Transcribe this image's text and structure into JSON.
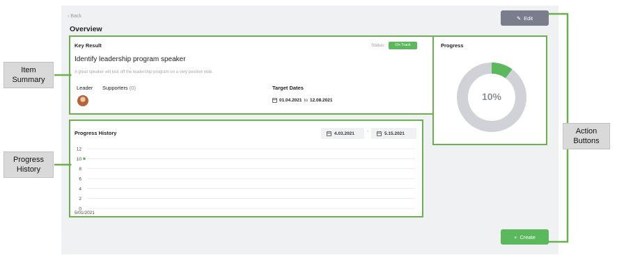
{
  "nav": {
    "back_label": "Back"
  },
  "page": {
    "title": "Overview"
  },
  "key_result": {
    "section_label": "Key Result",
    "status_label": "Status:",
    "status_badge": "On Track",
    "title": "Identify leadership program speaker",
    "description": "A great speaker will kick off the leadership program on a very positive note.",
    "leader_label": "Leader",
    "supporters_label": "Supporters",
    "supporters_count": "(0)",
    "target_dates_label": "Target Dates",
    "target_start": "01.04.2021",
    "target_to": "to",
    "target_end": "12.08.2021"
  },
  "progress": {
    "title": "Progress",
    "percent_text": "10%",
    "value": 0.1
  },
  "history": {
    "title": "Progress History",
    "date_start": "4.03.2021",
    "date_separator": "-",
    "date_end": "5.15.2021"
  },
  "buttons": {
    "edit_label": "Edit",
    "create_label": "Create"
  },
  "callouts": {
    "item_summary": "Item Summary",
    "progress_history": "Progress History",
    "action_buttons": "Action Buttons"
  },
  "colors": {
    "accent_green": "#5cb85c",
    "outline_green": "#6ab04c",
    "edit_gray": "#7a7e8c",
    "donut_track": "#d0d2d8"
  },
  "chart_data": {
    "type": "line",
    "x": [
      "5/01/2021"
    ],
    "yticks": [
      12,
      10,
      8,
      6,
      4,
      2,
      0
    ],
    "ylim": [
      0,
      12
    ],
    "series": [
      {
        "values": [
          10
        ]
      }
    ]
  }
}
